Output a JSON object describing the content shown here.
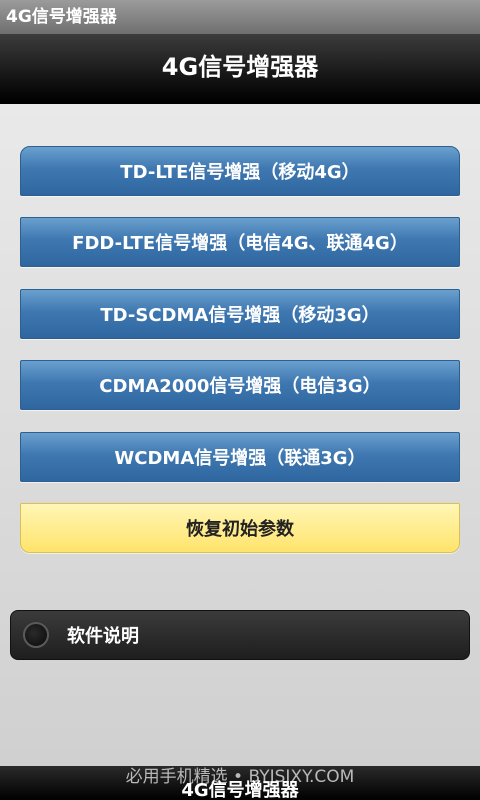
{
  "statusbar": {
    "title": "4G信号增强器"
  },
  "appbar": {
    "title": "4G信号增强器"
  },
  "buttons": [
    {
      "label": "TD-LTE信号增强（移动4G）"
    },
    {
      "label": "FDD-LTE信号增强（电信4G、联通4G）"
    },
    {
      "label": "TD-SCDMA信号增强（移动3G）"
    },
    {
      "label": "CDMA2000信号增强（电信3G）"
    },
    {
      "label": "WCDMA信号增强（联通3G）"
    }
  ],
  "reset": {
    "label": "恢复初始参数"
  },
  "toggle": {
    "label": "软件说明",
    "checked": false
  },
  "footer": {
    "watermark": "必用手机精选 • BYJSJXY.COM",
    "title": "4G信号增强器"
  },
  "colors": {
    "button_blue": "#3f78b1",
    "reset_yellow": "#ffe46b",
    "appbar_black": "#111111"
  }
}
